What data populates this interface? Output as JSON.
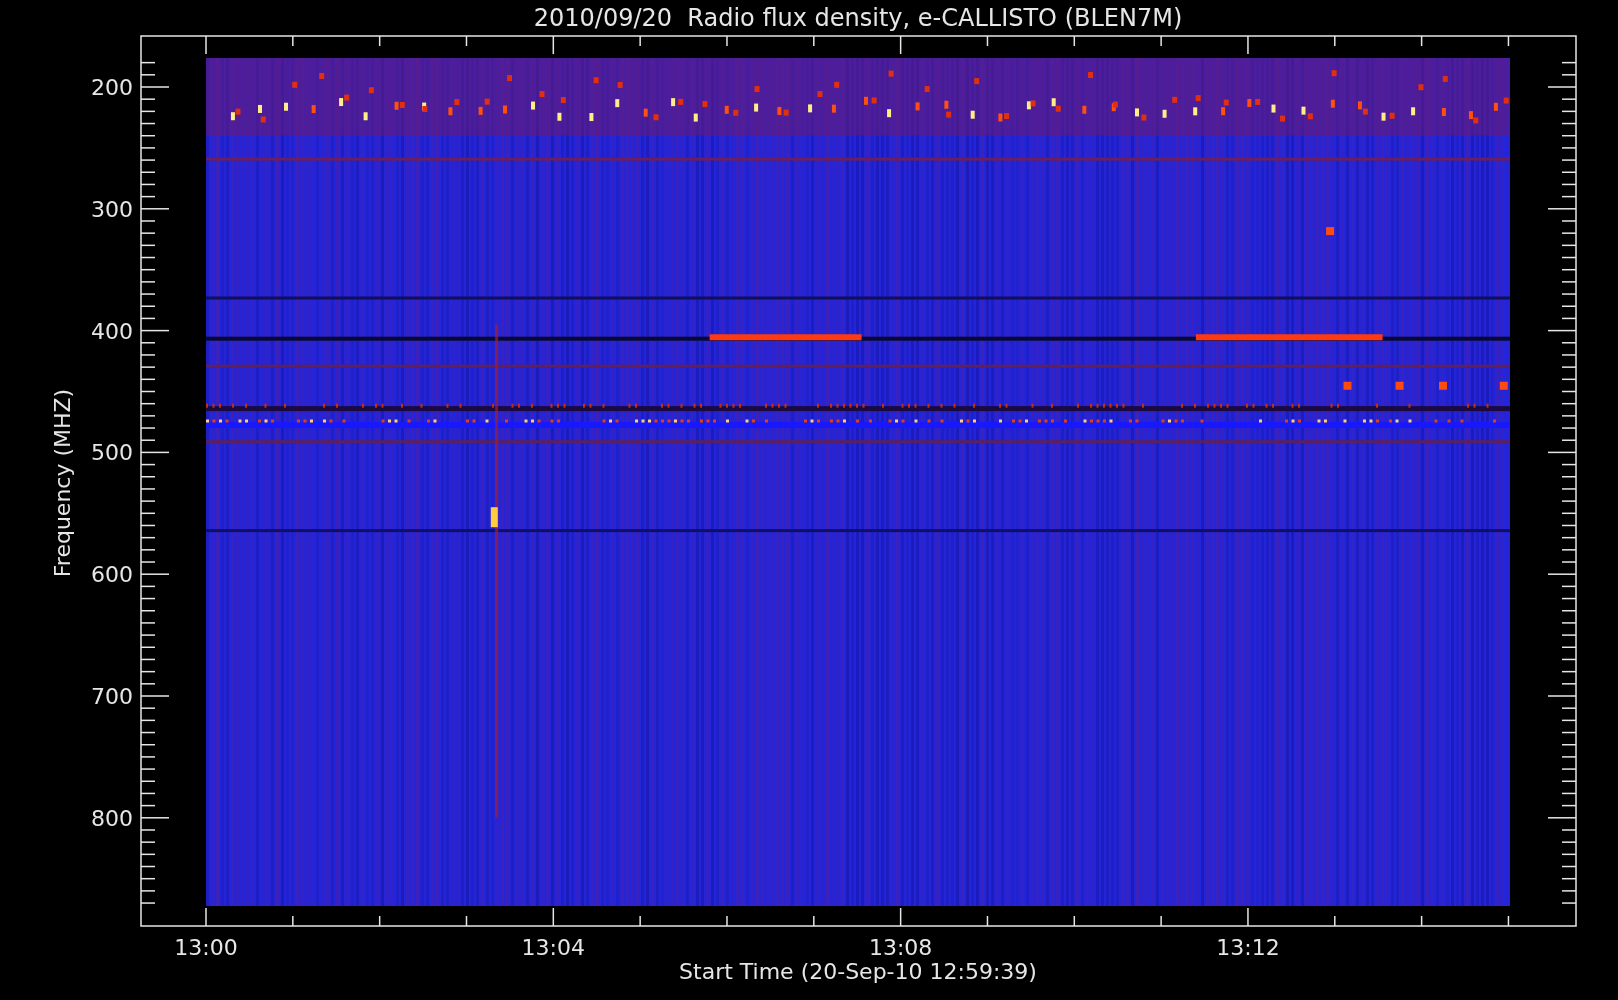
{
  "plot": {
    "title": "2010/09/20  Radio flux density, e-CALLISTO (BLEN7M)",
    "xlabel": "Start Time (20-Sep-10 12:59:39)",
    "ylabel": "Frequency (MHZ)",
    "xticks": [
      "13:00",
      "13:04",
      "13:08",
      "13:12"
    ],
    "yticks": [
      "200",
      "300",
      "400",
      "500",
      "600",
      "700",
      "800"
    ]
  }
}
